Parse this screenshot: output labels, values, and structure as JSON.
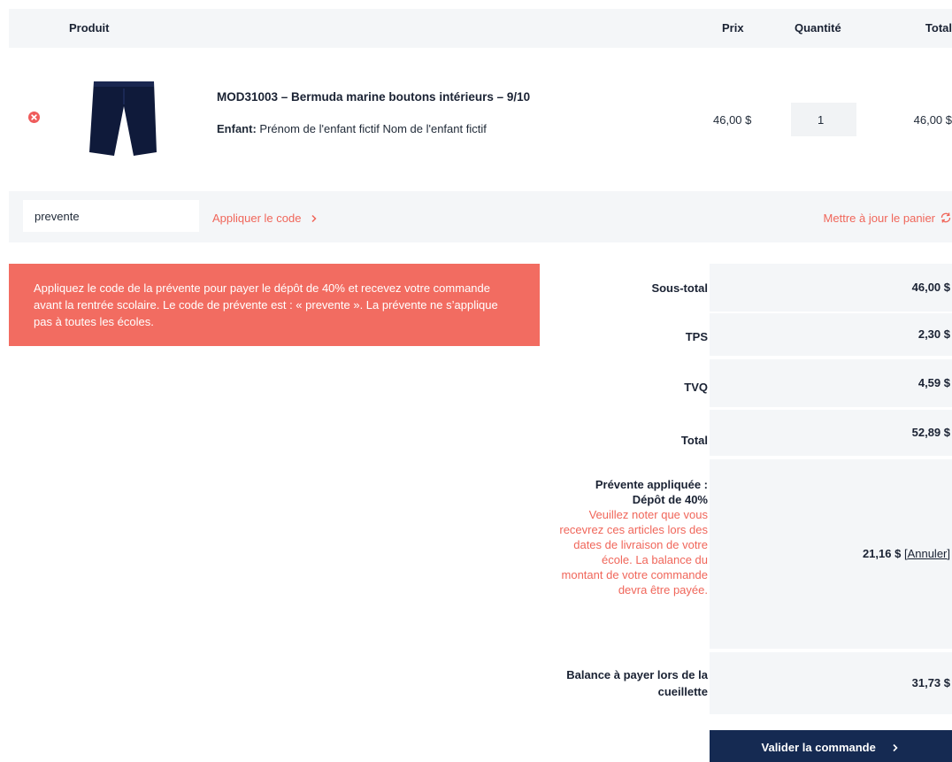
{
  "table": {
    "headers": {
      "product": "Produit",
      "price": "Prix",
      "quantity": "Quantité",
      "total": "Total"
    },
    "item": {
      "name": "MOD31003 – Bermuda marine boutons intérieurs – 9/10",
      "child_label": "Enfant:",
      "child_value": "Prénom de l'enfant fictif Nom de l'enfant fictif",
      "price": "46,00 $",
      "quantity": "1",
      "total": "46,00 $",
      "image_icon": "navy-shorts-image"
    }
  },
  "coupon": {
    "value": "prevente",
    "apply_label": "Appliquer le code",
    "apply_icon": "chevron-right-icon",
    "update_label": "Mettre à jour le panier",
    "update_icon": "refresh-icon"
  },
  "notice": {
    "text": "Appliquez le code de la prévente pour payer le dépôt de 40% et recevez votre commande avant la rentrée scolaire. Le code de prévente est : « prevente ». La prévente ne s’applique pas à toutes les écoles."
  },
  "totals": {
    "subtotal_label": "Sous-total",
    "subtotal_value": "46,00 $",
    "tps_label": "TPS",
    "tps_value": "2,30 $",
    "tvq_label": "TVQ",
    "tvq_value": "4,59 $",
    "total_label": "Total",
    "total_value": "52,89 $",
    "presale_label_1": "Prévente appliquée :",
    "presale_label_2": "Dépôt de 40%",
    "presale_warning": "Veuillez noter que vous recevrez ces articles lors des dates de livraison de votre école. La balance du montant de votre commande devra être payée.",
    "presale_value": "21,16 $",
    "presale_cancel": "[Annuler]",
    "balance_label": "Balance à payer lors de la cueillette",
    "balance_value": "31,73 $"
  },
  "actions": {
    "submit_label": "Valider la commande",
    "submit_icon": "chevron-right-icon"
  },
  "colors": {
    "accent": "#f0665a",
    "notice_bg": "#f26c61",
    "primary_button": "#152a52",
    "row_bg": "#f4f6f8"
  }
}
